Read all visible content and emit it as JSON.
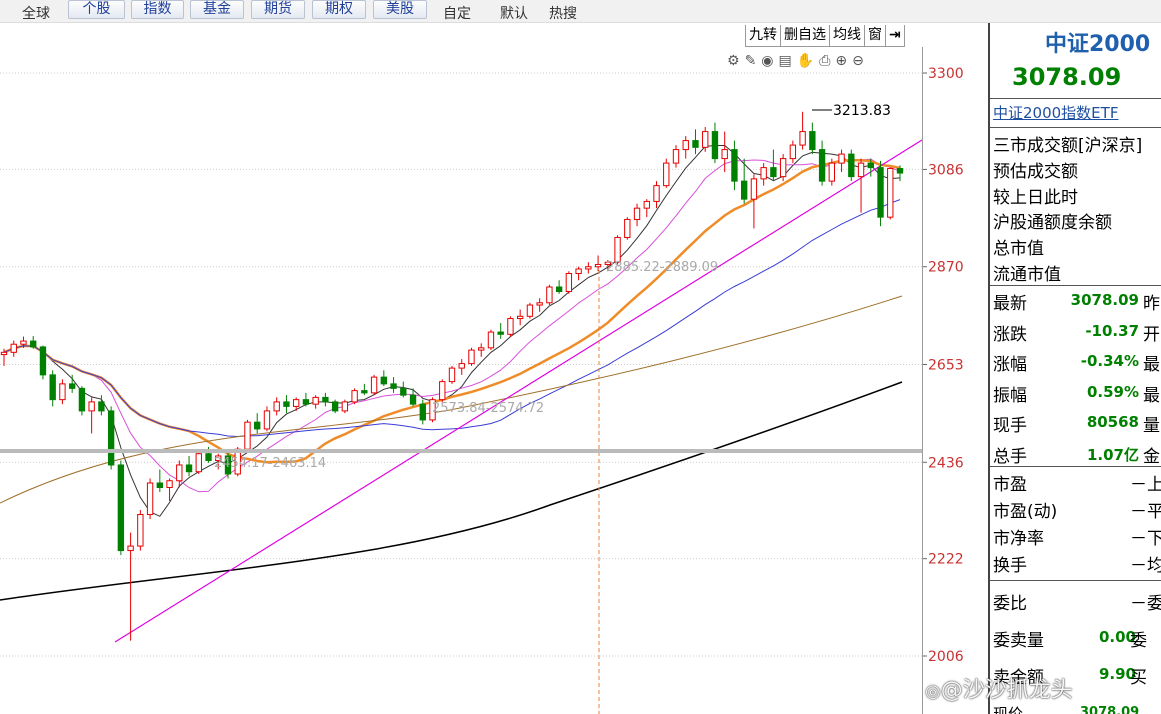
{
  "topbar": {
    "plain_left": "全球",
    "tabs": [
      "个股",
      "指数",
      "基金",
      "期货",
      "期权",
      "美股"
    ],
    "plain_right": [
      "自定",
      "默认",
      "热搜"
    ]
  },
  "chart_toolbar": [
    "九转",
    "删自选",
    "均线",
    "窗"
  ],
  "tool_icons": [
    "settings-icon",
    "pen-icon",
    "eye-icon",
    "calendar-icon",
    "hand-icon",
    "print-icon",
    "zoom-in-icon",
    "zoom-out-icon"
  ],
  "chart_data": {
    "type": "candlestick",
    "price_axis": [
      "3300",
      "3086",
      "2870",
      "2653",
      "2436",
      "2222",
      "2006"
    ],
    "annotations": {
      "high": "3213.83",
      "gap1": "2885.22-2889.09",
      "gap2": "2573.84-2574.72",
      "gap3": "2454.17-2463.14"
    },
    "ylim": [
      2006,
      3300
    ],
    "candles": [
      [
        2675,
        2688,
        2650,
        2680
      ],
      [
        2680,
        2706,
        2670,
        2698
      ],
      [
        2698,
        2715,
        2690,
        2705
      ],
      [
        2705,
        2716,
        2688,
        2692
      ],
      [
        2692,
        2695,
        2620,
        2630
      ],
      [
        2630,
        2640,
        2560,
        2575
      ],
      [
        2575,
        2620,
        2565,
        2610
      ],
      [
        2610,
        2630,
        2590,
        2600
      ],
      [
        2600,
        2605,
        2540,
        2550
      ],
      [
        2550,
        2580,
        2500,
        2570
      ],
      [
        2570,
        2585,
        2540,
        2550
      ],
      [
        2550,
        2560,
        2420,
        2430
      ],
      [
        2430,
        2440,
        2230,
        2240
      ],
      [
        2240,
        2280,
        2040,
        2250
      ],
      [
        2250,
        2330,
        2240,
        2320
      ],
      [
        2320,
        2400,
        2310,
        2390
      ],
      [
        2390,
        2420,
        2370,
        2380
      ],
      [
        2380,
        2400,
        2350,
        2395
      ],
      [
        2395,
        2440,
        2380,
        2430
      ],
      [
        2430,
        2450,
        2405,
        2415
      ],
      [
        2415,
        2460,
        2410,
        2455
      ],
      [
        2455,
        2470,
        2435,
        2440
      ],
      [
        2440,
        2455,
        2420,
        2450
      ],
      [
        2450,
        2460,
        2400,
        2410
      ],
      [
        2410,
        2470,
        2405,
        2465
      ],
      [
        2465,
        2530,
        2460,
        2525
      ],
      [
        2525,
        2545,
        2500,
        2510
      ],
      [
        2510,
        2560,
        2505,
        2550
      ],
      [
        2550,
        2580,
        2540,
        2570
      ],
      [
        2570,
        2585,
        2545,
        2560
      ],
      [
        2560,
        2580,
        2550,
        2575
      ],
      [
        2575,
        2590,
        2560,
        2565
      ],
      [
        2565,
        2585,
        2555,
        2580
      ],
      [
        2580,
        2590,
        2560,
        2570
      ],
      [
        2570,
        2575,
        2545,
        2550
      ],
      [
        2550,
        2575,
        2545,
        2570
      ],
      [
        2570,
        2600,
        2565,
        2595
      ],
      [
        2595,
        2610,
        2585,
        2590
      ],
      [
        2590,
        2630,
        2585,
        2625
      ],
      [
        2625,
        2640,
        2605,
        2610
      ],
      [
        2610,
        2625,
        2590,
        2600
      ],
      [
        2600,
        2615,
        2580,
        2585
      ],
      [
        2585,
        2600,
        2560,
        2565
      ],
      [
        2565,
        2575,
        2520,
        2530
      ],
      [
        2530,
        2580,
        2525,
        2575
      ],
      [
        2575,
        2620,
        2570,
        2615
      ],
      [
        2615,
        2650,
        2610,
        2645
      ],
      [
        2645,
        2665,
        2630,
        2655
      ],
      [
        2655,
        2690,
        2650,
        2685
      ],
      [
        2685,
        2700,
        2670,
        2690
      ],
      [
        2690,
        2730,
        2685,
        2725
      ],
      [
        2725,
        2745,
        2710,
        2720
      ],
      [
        2720,
        2760,
        2715,
        2755
      ],
      [
        2755,
        2775,
        2740,
        2760
      ],
      [
        2760,
        2790,
        2755,
        2785
      ],
      [
        2785,
        2800,
        2770,
        2790
      ],
      [
        2790,
        2830,
        2785,
        2825
      ],
      [
        2825,
        2840,
        2810,
        2815
      ],
      [
        2815,
        2860,
        2810,
        2855
      ],
      [
        2855,
        2870,
        2840,
        2865
      ],
      [
        2865,
        2880,
        2855,
        2870
      ],
      [
        2870,
        2895,
        2860,
        2875
      ],
      [
        2875,
        2885,
        2860,
        2880
      ],
      [
        2880,
        2940,
        2875,
        2935
      ],
      [
        2935,
        2980,
        2930,
        2975
      ],
      [
        2975,
        3010,
        2960,
        3000
      ],
      [
        3000,
        3020,
        2980,
        3015
      ],
      [
        3015,
        3060,
        3000,
        3050
      ],
      [
        3050,
        3110,
        3045,
        3100
      ],
      [
        3100,
        3140,
        3090,
        3130
      ],
      [
        3130,
        3160,
        3110,
        3150
      ],
      [
        3150,
        3175,
        3120,
        3135
      ],
      [
        3135,
        3180,
        3125,
        3170
      ],
      [
        3170,
        3190,
        3100,
        3110
      ],
      [
        3110,
        3170,
        3080,
        3130
      ],
      [
        3130,
        3150,
        3040,
        3060
      ],
      [
        3060,
        3110,
        3010,
        3020
      ],
      [
        3020,
        3075,
        2955,
        3065
      ],
      [
        3065,
        3100,
        3050,
        3090
      ],
      [
        3090,
        3130,
        3060,
        3070
      ],
      [
        3070,
        3120,
        3060,
        3110
      ],
      [
        3110,
        3150,
        3100,
        3140
      ],
      [
        3140,
        3214,
        3130,
        3170
      ],
      [
        3170,
        3190,
        3120,
        3130
      ],
      [
        3130,
        3150,
        3050,
        3060
      ],
      [
        3060,
        3110,
        3050,
        3100
      ],
      [
        3100,
        3130,
        3080,
        3120
      ],
      [
        3120,
        3130,
        3060,
        3070
      ],
      [
        3070,
        3110,
        2990,
        3100
      ],
      [
        3100,
        3110,
        3070,
        3090
      ],
      [
        3090,
        3105,
        2960,
        2980
      ],
      [
        2980,
        3090,
        2975,
        3088
      ],
      [
        3088,
        3095,
        3060,
        3078
      ]
    ]
  },
  "panel": {
    "title": "中证2000",
    "price": "3078.09",
    "etf": "中证2000指数ETF",
    "info_rows": [
      "三市成交额[沪深京]",
      "预估成交额",
      "较上日此时",
      "沪股通额度余额",
      "总市值",
      "流通市值"
    ],
    "quote_rows": [
      {
        "label": "最新",
        "value": "3078.09",
        "tail": "昨"
      },
      {
        "label": "涨跌",
        "value": "-10.37",
        "tail": "开"
      },
      {
        "label": "涨幅",
        "value": "-0.34%",
        "tail": "最"
      },
      {
        "label": "振幅",
        "value": "0.59%",
        "tail": "最"
      },
      {
        "label": "现手",
        "value": "80568",
        "tail": "量"
      },
      {
        "label": "总手",
        "value": "1.07亿",
        "tail": "金"
      }
    ],
    "pe_rows": [
      {
        "label": "市盈",
        "tail": "－上"
      },
      {
        "label": "市盈(动)",
        "tail": "－平"
      },
      {
        "label": "市净率",
        "tail": "－下"
      },
      {
        "label": "换手",
        "tail": "－均"
      }
    ],
    "order_rows": [
      {
        "label": "委比",
        "value": "",
        "tail": "－委"
      },
      {
        "label": "委卖量",
        "value": "0.00",
        "tail": "委"
      },
      {
        "label": "卖金额",
        "value": "9.90",
        "tail": "买"
      }
    ],
    "bottom_partial": {
      "label": "现价",
      "value": "3078.09"
    }
  },
  "watermark": "@沙沙抓龙头",
  "colors": {
    "up": "#e60000",
    "down": "#008000",
    "accent_blue": "#1f3a93",
    "accent_red": "#c81414"
  }
}
